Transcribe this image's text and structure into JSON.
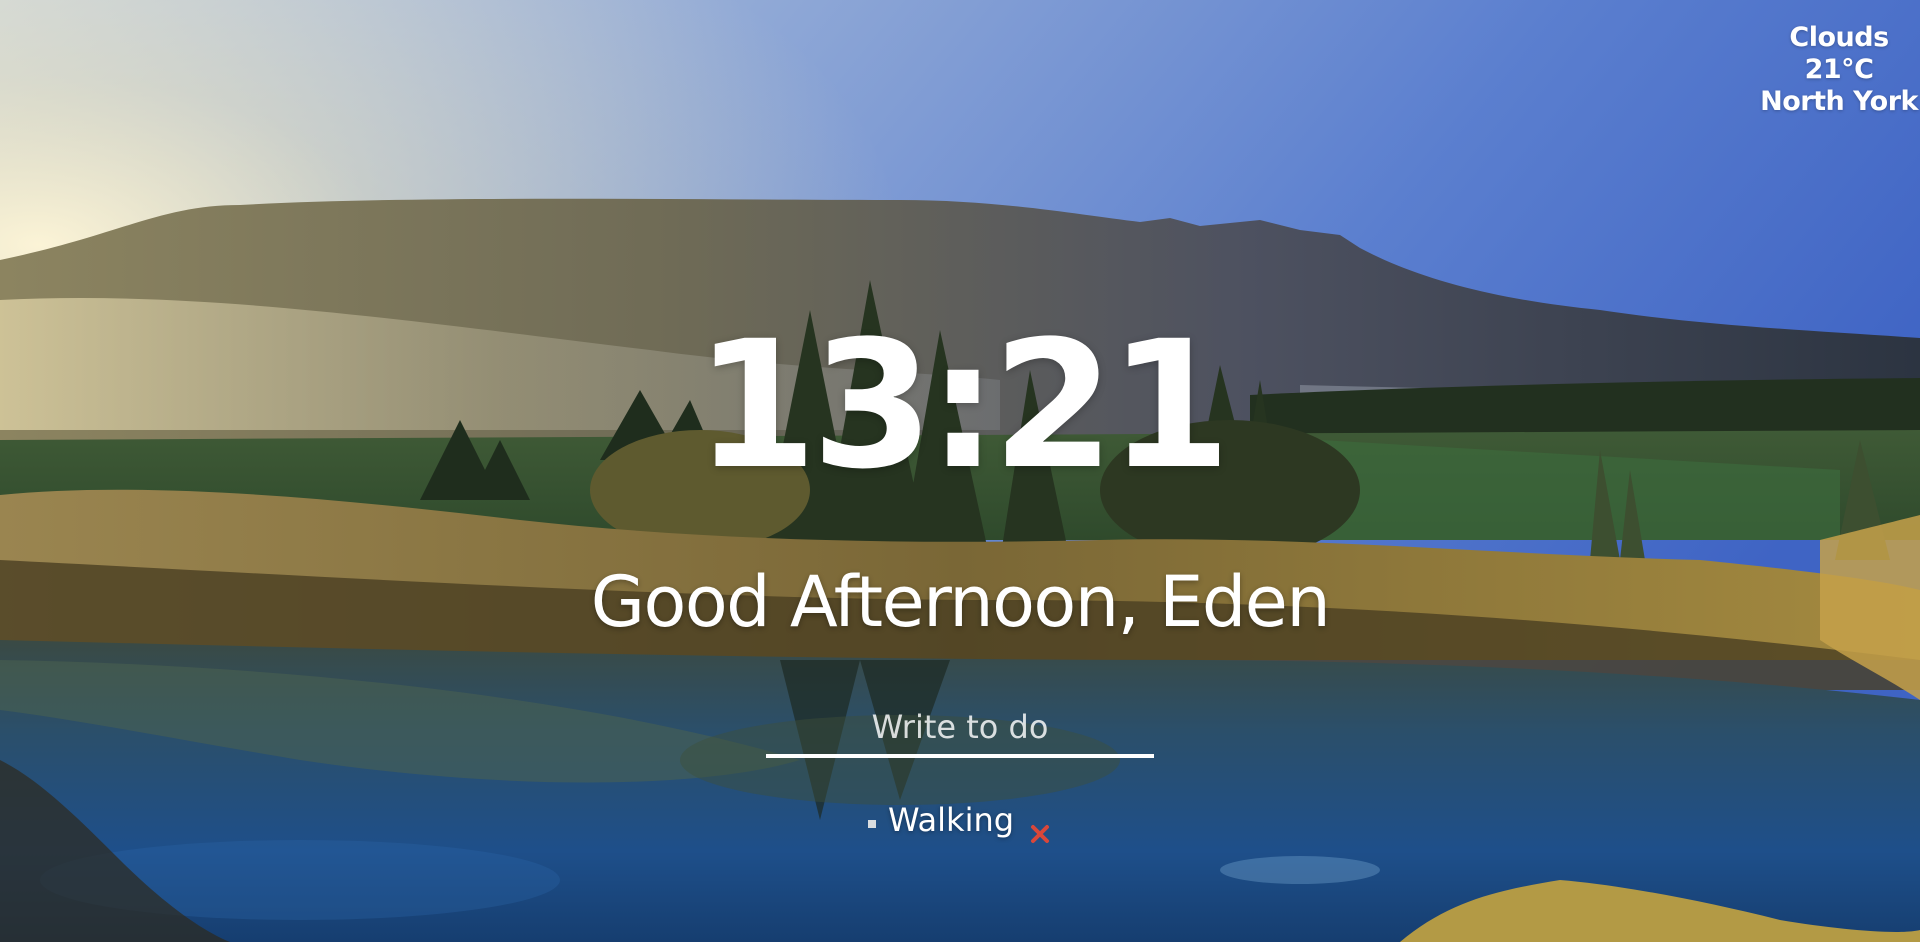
{
  "weather": {
    "condition": "Clouds",
    "temperature": "21°C",
    "location": "North York"
  },
  "clock": {
    "time": "13:21"
  },
  "greeting": {
    "text": "Good Afternoon, Eden"
  },
  "todo": {
    "placeholder": "Write to do",
    "value": "",
    "items": [
      {
        "label": "Walking",
        "delete_icon": "close-icon"
      }
    ]
  },
  "colors": {
    "text": "#ffffff",
    "delete_icon": "#d9473a",
    "sky_top": "#4a6cc4",
    "lake": "#1d4f86"
  }
}
